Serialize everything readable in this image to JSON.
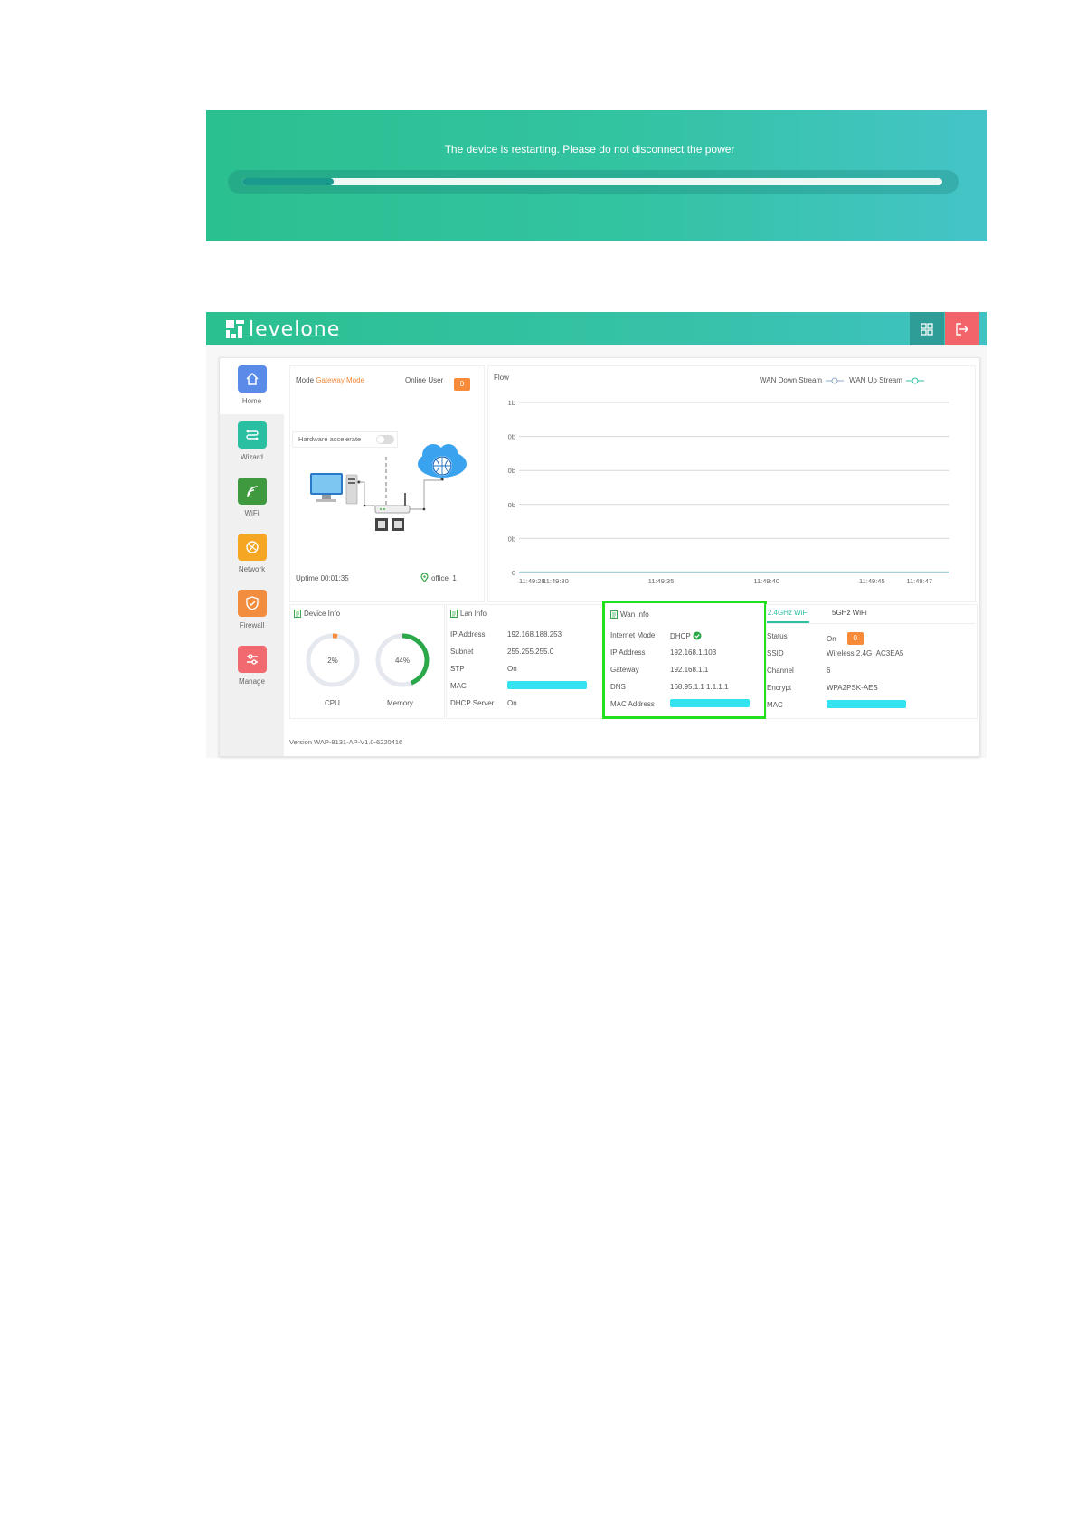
{
  "banner": {
    "message": "The device is restarting. Please do not disconnect the power",
    "progress_fraction": 0.13
  },
  "header": {
    "brand": "levelone",
    "grid_icon": "grid-icon",
    "logout_icon": "logout-icon"
  },
  "sidebar": {
    "items": [
      {
        "label": "Home",
        "icon": "home-icon",
        "color": "#5b8be8"
      },
      {
        "label": "Wizard",
        "icon": "wizard-icon",
        "color": "#2bbfa2"
      },
      {
        "label": "WiFi",
        "icon": "wifi-icon",
        "color": "#3f9a3f"
      },
      {
        "label": "Network",
        "icon": "network-icon",
        "color": "#f5a623"
      },
      {
        "label": "Firewall",
        "icon": "firewall-icon",
        "color": "#f28c3e"
      },
      {
        "label": "Manage",
        "icon": "manage-icon",
        "color": "#f06a6f"
      }
    ]
  },
  "overview": {
    "mode_label": "Mode",
    "mode_value": "Gateway Mode",
    "online_user_label": "Online User",
    "online_user_count": "0",
    "hw_accel_label": "Hardware accelerate",
    "uptime": "Uptime 00:01:35",
    "location": "office_1"
  },
  "flow": {
    "title": "Flow",
    "legend_down": "WAN Down Stream",
    "legend_up": "WAN Up Stream"
  },
  "chart_data": {
    "type": "line",
    "title": "Flow",
    "y_ticks": [
      "1b",
      "0b",
      "0b",
      "0b",
      "0b",
      "0"
    ],
    "x_ticks": [
      "11:49:28",
      "11:49:30",
      "11:49:35",
      "11:49:40",
      "11:49:45",
      "11:49:47"
    ],
    "series": [
      {
        "name": "WAN Down Stream",
        "values": [
          0,
          0,
          0,
          0,
          0,
          0
        ]
      },
      {
        "name": "WAN Up Stream",
        "values": [
          0,
          0,
          0,
          0,
          0,
          0
        ]
      }
    ],
    "grid": true,
    "legend": "top-right"
  },
  "device_info": {
    "title": "Device Info",
    "cpu_label": "CPU",
    "cpu_percent": 2,
    "cpu_text": "2%",
    "memory_label": "Memory",
    "memory_percent": 44,
    "memory_text": "44%"
  },
  "lan_info": {
    "title": "Lan Info",
    "rows": [
      {
        "key": "IP Address",
        "value": "192.168.188.253"
      },
      {
        "key": "Subnet",
        "value": "255.255.255.0"
      },
      {
        "key": "STP",
        "value": "On"
      },
      {
        "key": "MAC",
        "value": ""
      },
      {
        "key": "DHCP Server",
        "value": "On"
      }
    ]
  },
  "wan_info": {
    "title": "Wan Info",
    "rows": [
      {
        "key": "Internet Mode",
        "value": "DHCP"
      },
      {
        "key": "IP Address",
        "value": "192.168.1.103"
      },
      {
        "key": "Gateway",
        "value": "192.168.1.1"
      },
      {
        "key": "DNS",
        "value": "168.95.1.1 1.1.1.1"
      },
      {
        "key": "MAC Address",
        "value": ""
      }
    ]
  },
  "wifi_info": {
    "tab_24": "2.4GHz WiFi",
    "tab_5": "5GHz WiFi",
    "rows": [
      {
        "key": "Status",
        "value": "On"
      },
      {
        "key": "SSID",
        "value": "Wireless 2.4G_AC3EA5"
      },
      {
        "key": "Channel",
        "value": "6"
      },
      {
        "key": "Encrypt",
        "value": "WPA2PSK-AES"
      },
      {
        "key": "MAC",
        "value": ""
      }
    ],
    "status_badge": "0"
  },
  "footer": {
    "version": "Version  WAP-8131-AP-V1.0-6220416"
  }
}
